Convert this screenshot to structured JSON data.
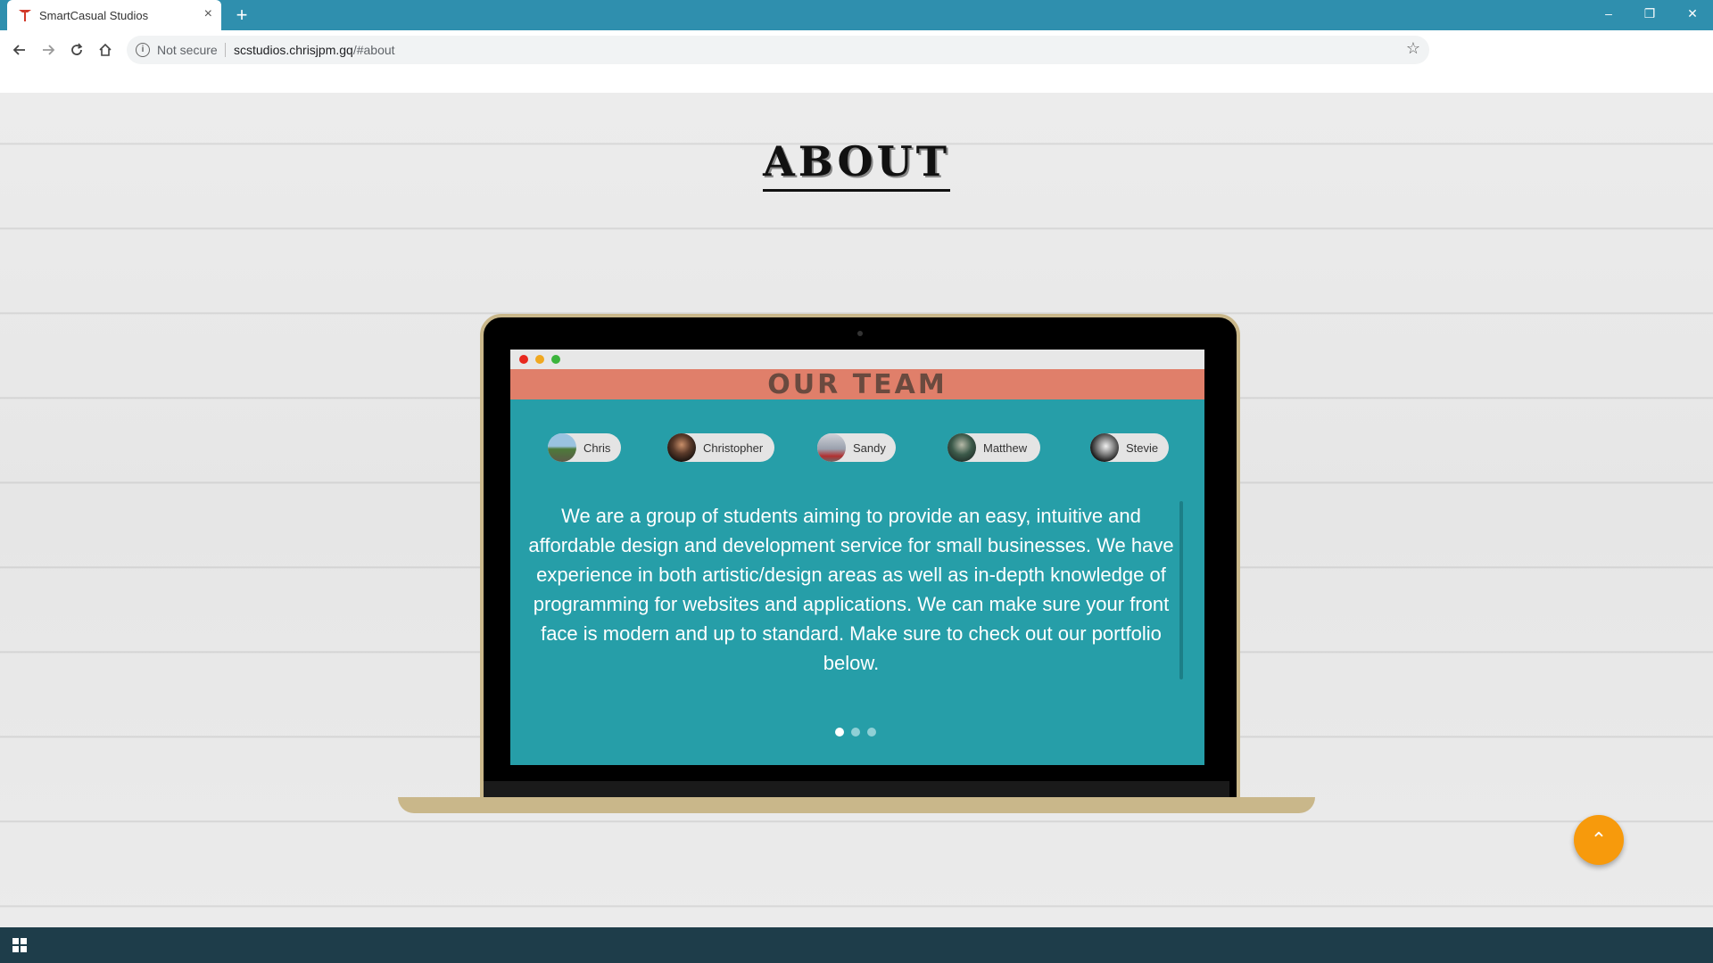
{
  "browser": {
    "tab_title": "SmartCasual Studios",
    "tab_close": "×",
    "new_tab": "+",
    "security_label": "Not secure",
    "url_host": "scstudios.chrisjpm.gq",
    "url_path": "/#about",
    "window_controls": {
      "minimize": "–",
      "restore": "❐",
      "close": "✕"
    }
  },
  "page": {
    "section_title": "ABOUT",
    "team_title": "OUR TEAM",
    "members": [
      {
        "name": "Chris"
      },
      {
        "name": "Christopher"
      },
      {
        "name": "Sandy"
      },
      {
        "name": "Matthew"
      },
      {
        "name": "Stevie"
      }
    ],
    "about_text": "We are a group of students aiming to provide an easy, intuitive and affordable design and development service for small businesses. We have experience in both artistic/design areas as well as in-depth knowledge of programming for websites and applications. We can make sure your front face is modern and up to standard. Make sure to check out our portfolio below.",
    "carousel": {
      "active_index": 0,
      "count": 3
    },
    "scroll_top_icon": "⌃"
  },
  "colors": {
    "tabbar": "#2f8fae",
    "screen": "#269ea8",
    "header": "#e07f6a",
    "laptop_frame": "#c9b78a",
    "scroll_button": "#f79a0c",
    "taskbar": "#1e3d4a"
  },
  "icons": {
    "favicon": "smartcasual-logo-icon",
    "back": "arrow-left-icon",
    "forward": "arrow-right-icon",
    "reload": "reload-icon",
    "home": "home-icon",
    "info": "info-icon",
    "star": "star-icon",
    "start": "windows-start-icon",
    "scroll_top": "chevron-up-icon"
  }
}
